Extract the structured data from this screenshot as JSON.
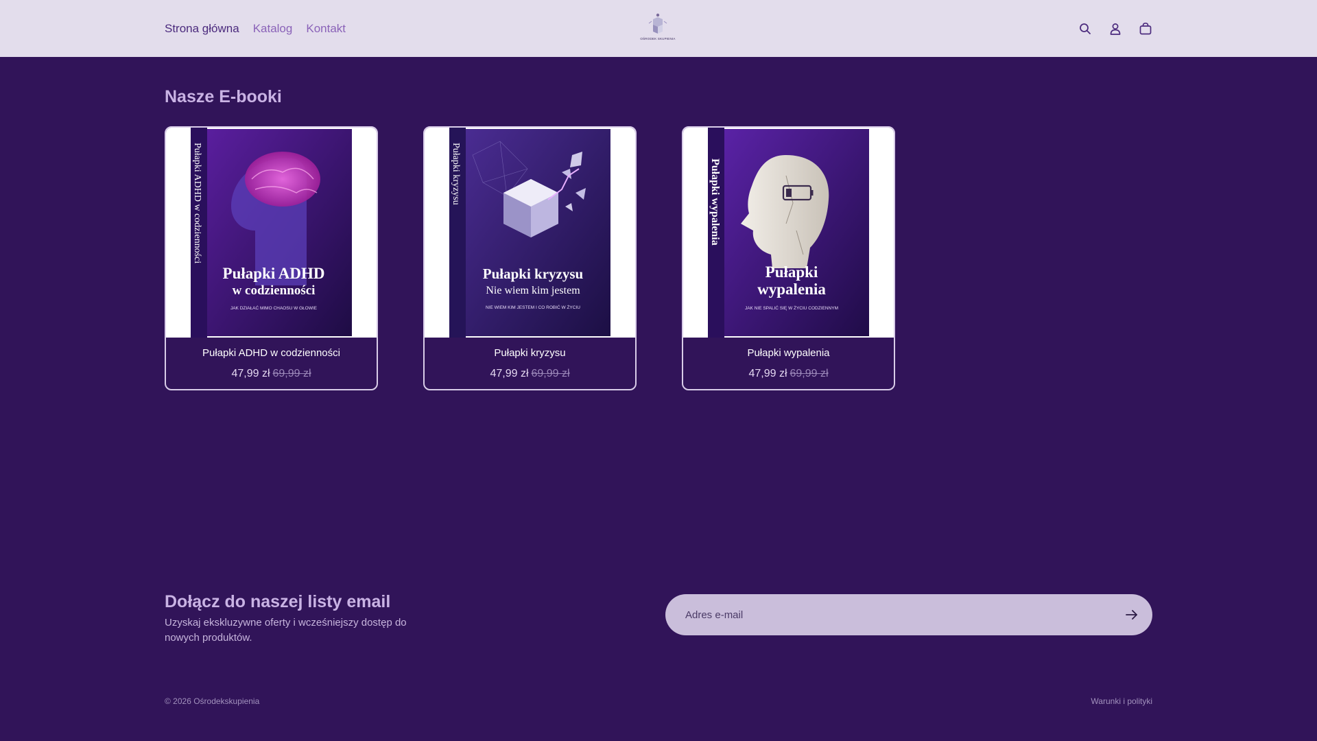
{
  "header": {
    "nav": [
      {
        "label": "Strona główna"
      },
      {
        "label": "Katalog"
      },
      {
        "label": "Kontakt"
      }
    ],
    "logo_text": "OŚRODEK SKUPIENIA",
    "icons": [
      "search-icon",
      "account-icon",
      "cart-icon"
    ]
  },
  "section": {
    "title": "Nasze E-booki"
  },
  "products": [
    {
      "title": "Pułapki ADHD w codzienności",
      "price": "47,99 zł",
      "old_price": "69,99 zł",
      "cover": {
        "spine": "Pułapki ADHD w codzienności",
        "line1": "Pułapki ADHD",
        "line2": "w codzienności",
        "tagline": "JAK DZIAŁAĆ MIMO CHAOSU W GŁOWIE"
      }
    },
    {
      "title": "Pułapki kryzysu",
      "price": "47,99 zł",
      "old_price": "69,99 zł",
      "cover": {
        "spine": "Pułapki kryzysu",
        "line1": "Pułapki kryzysu",
        "line2": "Nie wiem kim jestem",
        "tagline": "NIE WIEM KIM JESTEM I CO ROBIĆ W ŻYCIU"
      }
    },
    {
      "title": "Pułapki wypalenia",
      "price": "47,99 zł",
      "old_price": "69,99 zł",
      "cover": {
        "spine": "Pułapki wypalenia",
        "line1": "Pułapki",
        "line2": "wypalenia",
        "tagline": "JAK NIE SPALIĆ SIĘ W ŻYCIU CODZIENNYM"
      }
    }
  ],
  "newsletter": {
    "title": "Dołącz do naszej listy email",
    "subtitle": "Uzyskaj ekskluzywne oferty i wcześniejszy dostęp do nowych produktów.",
    "placeholder": "Adres e-mail"
  },
  "footer": {
    "copyright": "© 2026 Ośrodekskupienia",
    "policies": "Warunki i polityki"
  },
  "colors": {
    "background": "#311459",
    "header": "#e3ddec",
    "accent": "#8a62b8"
  }
}
